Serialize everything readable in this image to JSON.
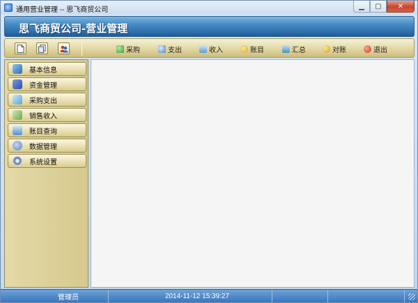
{
  "window": {
    "title": "通用营业管理 -- 思飞商贸公司"
  },
  "banner": {
    "title": "思飞商贸公司-营业管理"
  },
  "toolbar": {
    "quick_buttons": [
      {
        "icon": "new-document-icon"
      },
      {
        "icon": "copy-document-icon"
      },
      {
        "icon": "users-icon"
      }
    ],
    "items": [
      {
        "label": "采购",
        "icon": "purchase-icon",
        "color": "#3d9b3a"
      },
      {
        "label": "支出",
        "icon": "expense-icon",
        "color": "#4a86c8"
      },
      {
        "label": "收入",
        "icon": "income-icon",
        "color": "#5b9bd5"
      },
      {
        "label": "账目",
        "icon": "accounts-icon",
        "color": "#d9a520"
      },
      {
        "label": "汇总",
        "icon": "summary-icon",
        "color": "#4a8fc0"
      },
      {
        "label": "对账",
        "icon": "reconcile-icon",
        "color": "#d4a017"
      },
      {
        "label": "退出",
        "icon": "exit-icon",
        "color": "#d23b2a"
      }
    ]
  },
  "sidebar": {
    "items": [
      {
        "label": "基本信息",
        "icon": "basic-info-icon",
        "color": "#2d6fb8"
      },
      {
        "label": "资金管理",
        "icon": "fund-management-icon",
        "color": "#2c4fa6"
      },
      {
        "label": "采购支出",
        "icon": "purchase-expense-icon",
        "color": "#5aa3d8"
      },
      {
        "label": "销售收入",
        "icon": "sales-income-icon",
        "color": "#6aa84f"
      },
      {
        "label": "账目查询",
        "icon": "account-query-icon",
        "color": "#4a90c8"
      },
      {
        "label": "数据管理",
        "icon": "data-management-icon",
        "color": "#5b7fc8"
      },
      {
        "label": "系统设置",
        "icon": "system-settings-icon",
        "color": "#7a8fb8"
      }
    ]
  },
  "statusbar": {
    "user": "管理员",
    "datetime": "2014-11-12 15:39:27"
  }
}
